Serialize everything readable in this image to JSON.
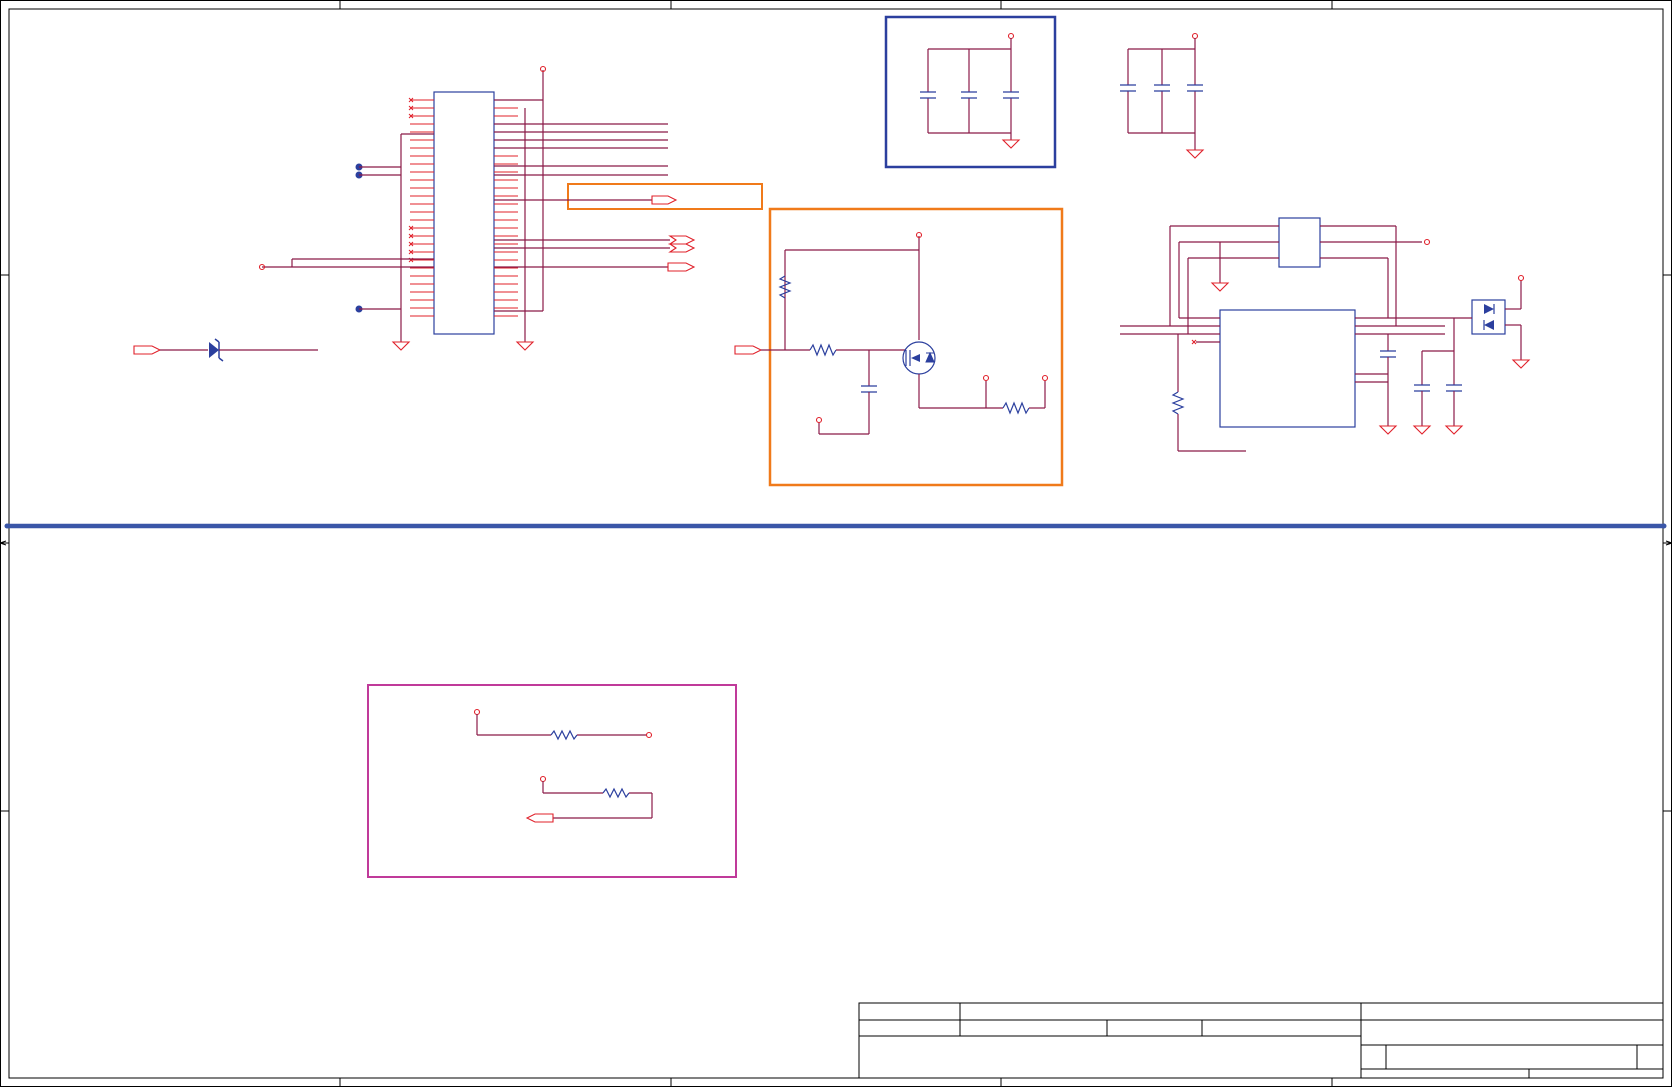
{
  "title": "",
  "colors": {
    "wire": "#8b1a48",
    "pin": "#e0202a",
    "component": "#2b3f9e",
    "frame": "#000000",
    "group_orange": "#f07a1a",
    "group_blue": "#2b3f9e",
    "group_magenta": "#c03a9a",
    "divider": "#3a56a8"
  },
  "icons": {
    "resistor": "zigzag",
    "capacitor": "parallel-plates",
    "ground": "down-triangle",
    "power-port": "small-circle",
    "off-page-connector": "pentagon-arrow",
    "zener-diode": "triangle-bar",
    "mosfet": "circle-transistor",
    "dual-diode": "diode-pair",
    "junction": "filled-dot",
    "no-connect": "x-mark"
  }
}
